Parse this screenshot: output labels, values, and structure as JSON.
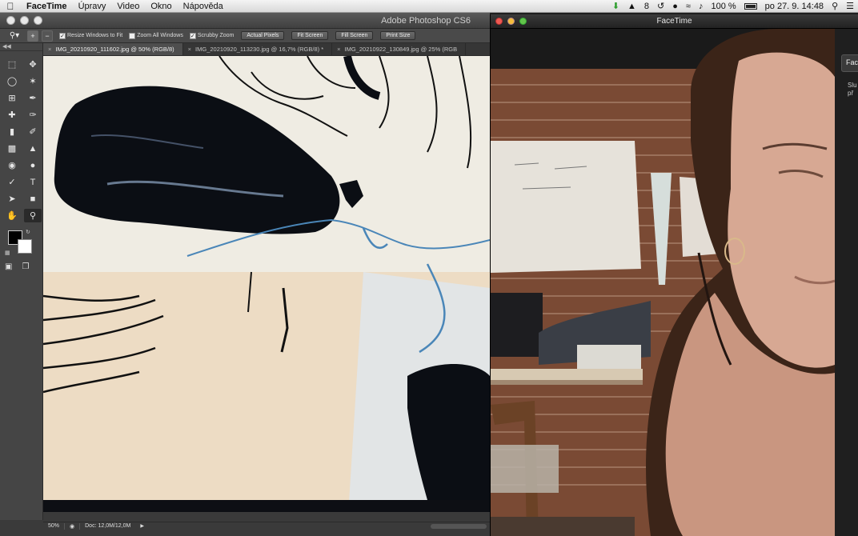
{
  "menubar": {
    "app_name": "FaceTime",
    "menus": [
      "Úpravy",
      "Video",
      "Okno",
      "Nápověda"
    ],
    "status": {
      "notifications": "8",
      "battery": "100 %",
      "datetime": "po 27. 9.  14:48"
    }
  },
  "photoshop": {
    "title": "Adobe Photoshop CS6",
    "options": {
      "resize_windows": "Resize Windows to Fit",
      "zoom_all": "Zoom All Windows",
      "scrubby_zoom": "Scrubby Zoom",
      "actual_pixels": "Actual Pixels",
      "fit_screen": "Fit Screen",
      "fill_screen": "Fill Screen",
      "print_size": "Print Size"
    },
    "tabs": [
      {
        "label": "IMG_20210920_111602.jpg @ 50% (RGB/8)"
      },
      {
        "label": "IMG_20210920_113230.jpg @ 16,7% (RGB/8) *"
      },
      {
        "label": "IMG_20210922_130849.jpg @ 25% (RGB"
      }
    ],
    "status": {
      "zoom": "50%",
      "doc": "Doc: 12,0M/12,0M"
    }
  },
  "facetime": {
    "title": "FaceTime",
    "side_button": "Face",
    "side_text_1": "Slu",
    "side_text_2": "př"
  }
}
